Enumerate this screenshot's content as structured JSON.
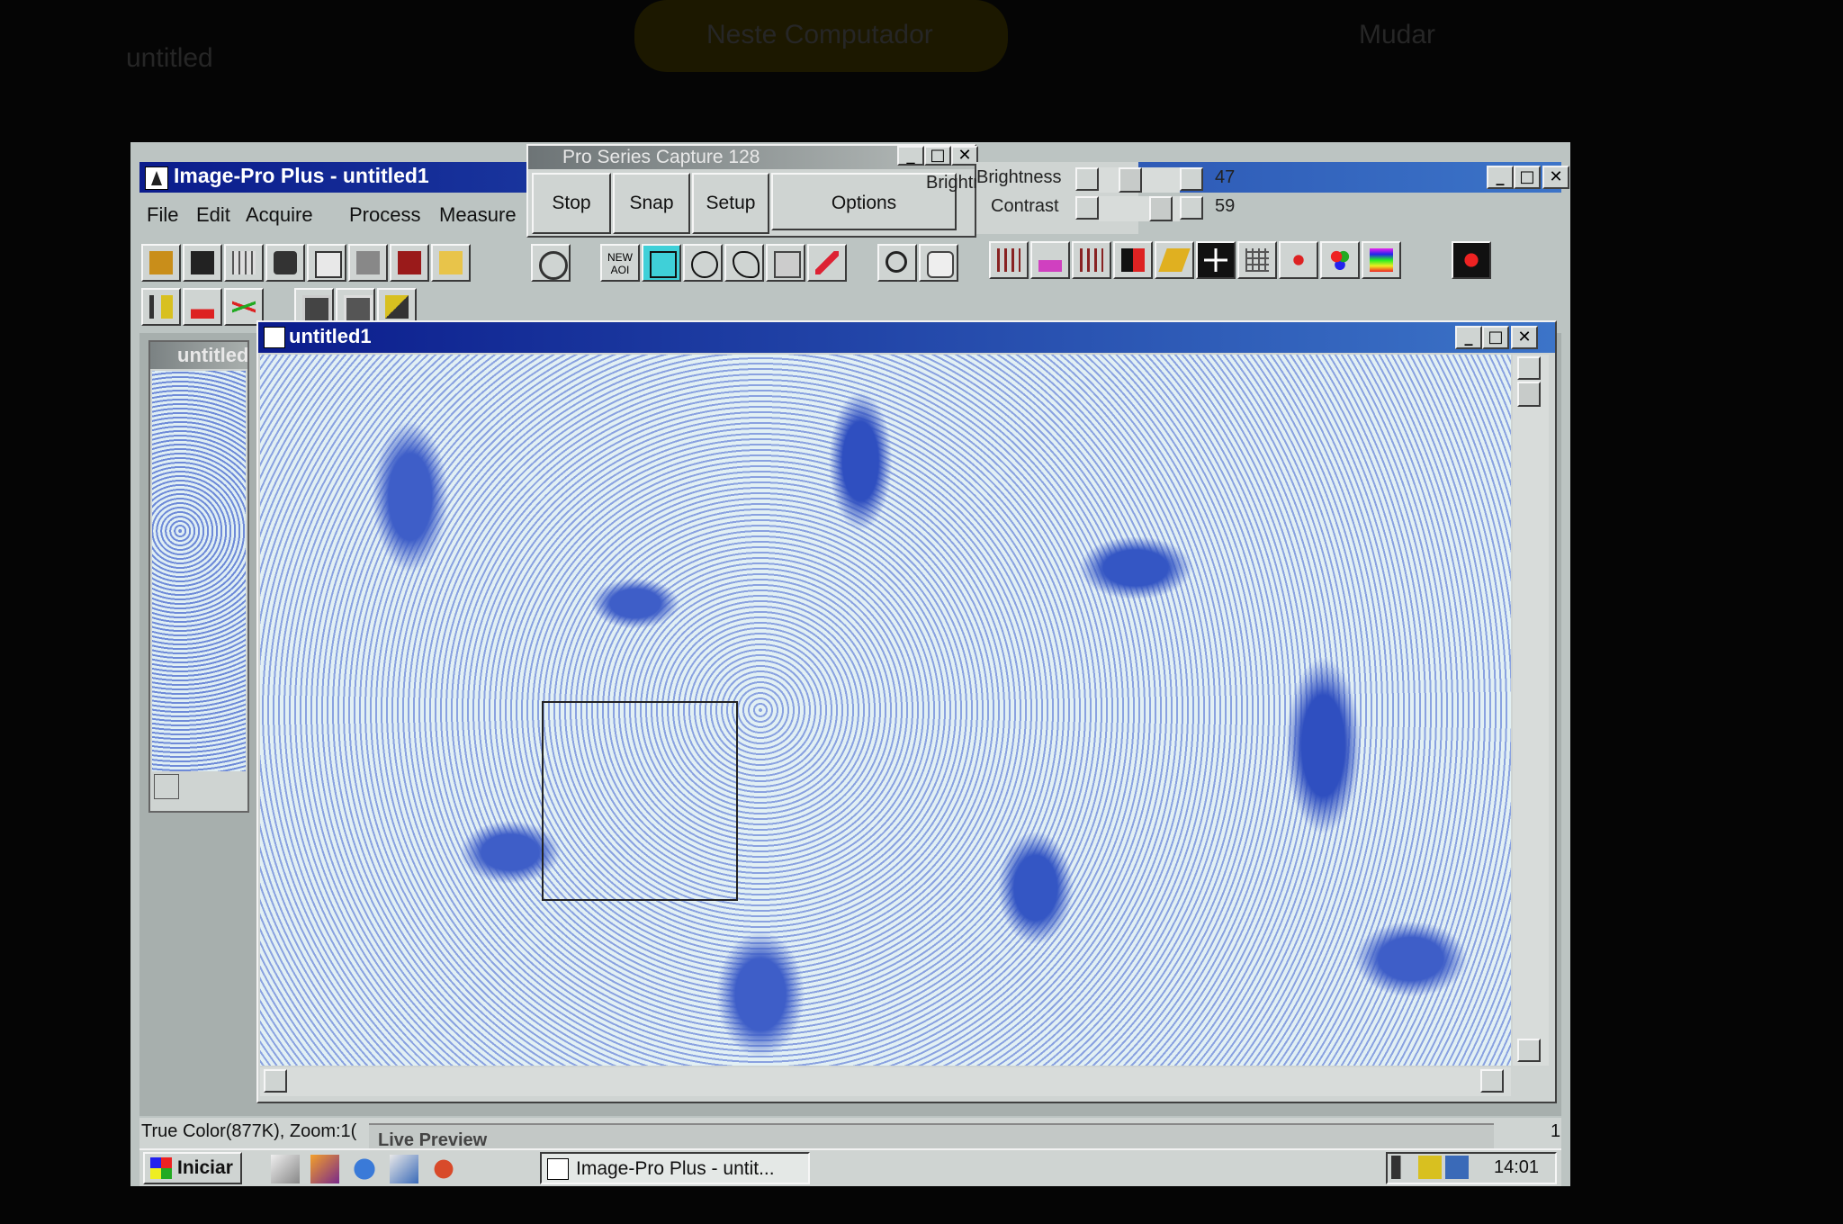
{
  "background": {
    "left_text": "untitled",
    "center_text": "Neste Computador",
    "right_text": "Mudar"
  },
  "main_window": {
    "title": "Image-Pro Plus - untitled1",
    "menu": [
      "File",
      "Edit",
      "Acquire",
      "Process",
      "Measure"
    ]
  },
  "capture_panel": {
    "title": "Pro Series Capture 128",
    "buttons": [
      "Stop",
      "Snap",
      "Setup",
      "Options"
    ],
    "brightness_label": "Brightness",
    "brightness_value": "47",
    "contrast_label": "Contrast",
    "contrast_value": "59"
  },
  "toolbar": {
    "new_aoi_label": "NEW AOI"
  },
  "left_window": {
    "title": "untitled"
  },
  "image_window": {
    "title": "untitled1"
  },
  "status_bar": {
    "text": "True Color(877K), Zoom:1(",
    "live_preview": "Live Preview",
    "page": "1"
  },
  "taskbar": {
    "start_label": "Iniciar",
    "task_label": "Image-Pro Plus - untit...",
    "clock": "14:01"
  }
}
